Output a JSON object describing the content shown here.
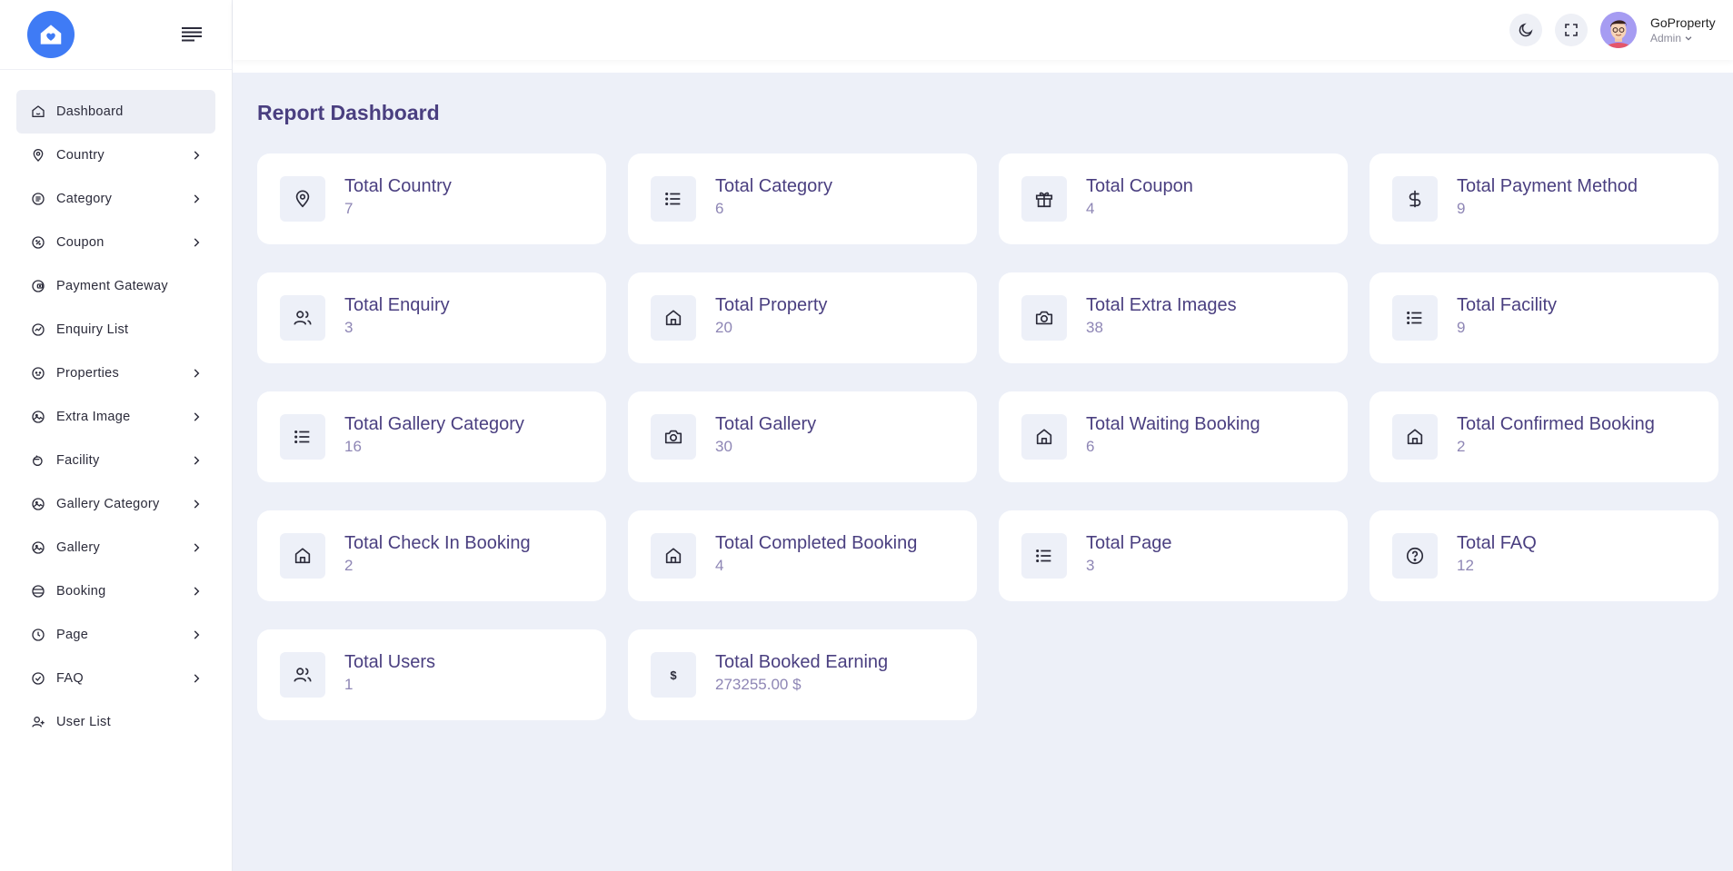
{
  "brand": {
    "accent": "#3f7bf5",
    "title_color": "#4a3f80"
  },
  "sidebar": {
    "items": [
      {
        "label": "Dashboard",
        "icon": "home-icon",
        "active": true,
        "has_children": false
      },
      {
        "label": "Country",
        "icon": "map-pin-icon",
        "active": false,
        "has_children": true
      },
      {
        "label": "Category",
        "icon": "category-icon",
        "active": false,
        "has_children": true
      },
      {
        "label": "Coupon",
        "icon": "coupon-icon",
        "active": false,
        "has_children": true
      },
      {
        "label": "Payment Gateway",
        "icon": "wallet-icon",
        "active": false,
        "has_children": false
      },
      {
        "label": "Enquiry List",
        "icon": "chart-icon",
        "active": false,
        "has_children": false
      },
      {
        "label": "Properties",
        "icon": "building-icon",
        "active": false,
        "has_children": true
      },
      {
        "label": "Extra Image",
        "icon": "image-icon",
        "active": false,
        "has_children": true
      },
      {
        "label": "Facility",
        "icon": "pan-icon",
        "active": false,
        "has_children": true
      },
      {
        "label": "Gallery Category",
        "icon": "image-icon",
        "active": false,
        "has_children": true
      },
      {
        "label": "Gallery",
        "icon": "image-icon",
        "active": false,
        "has_children": true
      },
      {
        "label": "Booking",
        "icon": "booking-icon",
        "active": false,
        "has_children": true
      },
      {
        "label": "Page",
        "icon": "page-icon",
        "active": false,
        "has_children": true
      },
      {
        "label": "FAQ",
        "icon": "check-circle-icon",
        "active": false,
        "has_children": true
      },
      {
        "label": "User List",
        "icon": "user-plus-icon",
        "active": false,
        "has_children": false
      }
    ]
  },
  "header": {
    "user_name": "GoProperty",
    "user_role": "Admin"
  },
  "main": {
    "title": "Report Dashboard",
    "cards": [
      {
        "title": "Total Country",
        "value": "7",
        "icon": "map-pin-icon"
      },
      {
        "title": "Total Category",
        "value": "6",
        "icon": "list-icon"
      },
      {
        "title": "Total Coupon",
        "value": "4",
        "icon": "gift-icon"
      },
      {
        "title": "Total Payment Method",
        "value": "9",
        "icon": "dollar-icon"
      },
      {
        "title": "Total Enquiry",
        "value": "3",
        "icon": "users-icon"
      },
      {
        "title": "Total Property",
        "value": "20",
        "icon": "home-icon"
      },
      {
        "title": "Total Extra Images",
        "value": "38",
        "icon": "camera-icon"
      },
      {
        "title": "Total Facility",
        "value": "9",
        "icon": "list-icon"
      },
      {
        "title": "Total Gallery Category",
        "value": "16",
        "icon": "list-icon"
      },
      {
        "title": "Total Gallery",
        "value": "30",
        "icon": "camera-icon"
      },
      {
        "title": "Total Waiting Booking",
        "value": "6",
        "icon": "home-icon"
      },
      {
        "title": "Total Confirmed Booking",
        "value": "2",
        "icon": "home-icon"
      },
      {
        "title": "Total Check In Booking",
        "value": "2",
        "icon": "home-icon"
      },
      {
        "title": "Total Completed Booking",
        "value": "4",
        "icon": "home-icon"
      },
      {
        "title": "Total Page",
        "value": "3",
        "icon": "list-icon"
      },
      {
        "title": "Total FAQ",
        "value": "12",
        "icon": "help-circle-icon"
      },
      {
        "title": "Total Users",
        "value": "1",
        "icon": "users-icon"
      },
      {
        "title": "Total Booked Earning",
        "value": "273255.00 $",
        "icon": "dollar-sign-icon",
        "icon_text": "$"
      }
    ]
  }
}
